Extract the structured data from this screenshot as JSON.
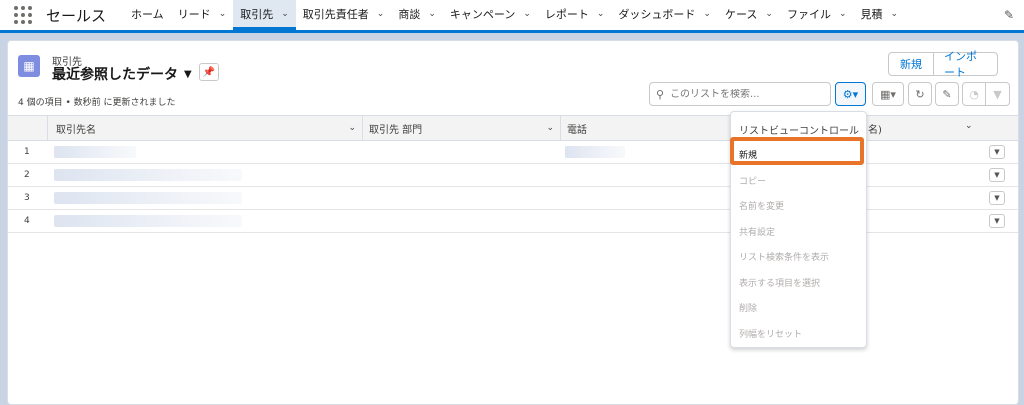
{
  "app": {
    "name": "セールス"
  },
  "nav": {
    "tabs": [
      {
        "label": "ホーム",
        "chevron": false
      },
      {
        "label": "リード",
        "chevron": true
      },
      {
        "label": "取引先",
        "chevron": true,
        "active": true
      },
      {
        "label": "取引先責任者",
        "chevron": true
      },
      {
        "label": "商談",
        "chevron": true
      },
      {
        "label": "キャンペーン",
        "chevron": true
      },
      {
        "label": "レポート",
        "chevron": true
      },
      {
        "label": "ダッシュボード",
        "chevron": true
      },
      {
        "label": "ケース",
        "chevron": true
      },
      {
        "label": "ファイル",
        "chevron": true
      },
      {
        "label": "見積",
        "chevron": true
      }
    ]
  },
  "header": {
    "object_label": "取引先",
    "view_name": "最近参照したデータ",
    "status": "4 個の項目 • 数秒前 に更新されました",
    "new_button": "新規",
    "import_button": "インポート"
  },
  "search": {
    "placeholder": "このリストを検索..."
  },
  "table": {
    "columns": [
      "取引先名",
      "取引先 部門",
      "電話"
    ],
    "partial_column_tail": "名)",
    "rows": [
      {
        "num": "1"
      },
      {
        "num": "2"
      },
      {
        "num": "3"
      },
      {
        "num": "4"
      }
    ]
  },
  "menu": {
    "header": "リストビューコントロール",
    "items": [
      {
        "label": "新規",
        "enabled": true
      },
      {
        "label": "コピー",
        "enabled": false
      },
      {
        "label": "名前を変更",
        "enabled": false
      },
      {
        "label": "共有設定",
        "enabled": false
      },
      {
        "label": "リスト検索条件を表示",
        "enabled": false
      },
      {
        "label": "表示する項目を選択",
        "enabled": false
      },
      {
        "label": "削除",
        "enabled": false
      },
      {
        "label": "列幅をリセット",
        "enabled": false
      }
    ]
  },
  "colors": {
    "brand": "#0176d3",
    "highlight": "#e8742a",
    "object_icon": "#7f8de1"
  }
}
